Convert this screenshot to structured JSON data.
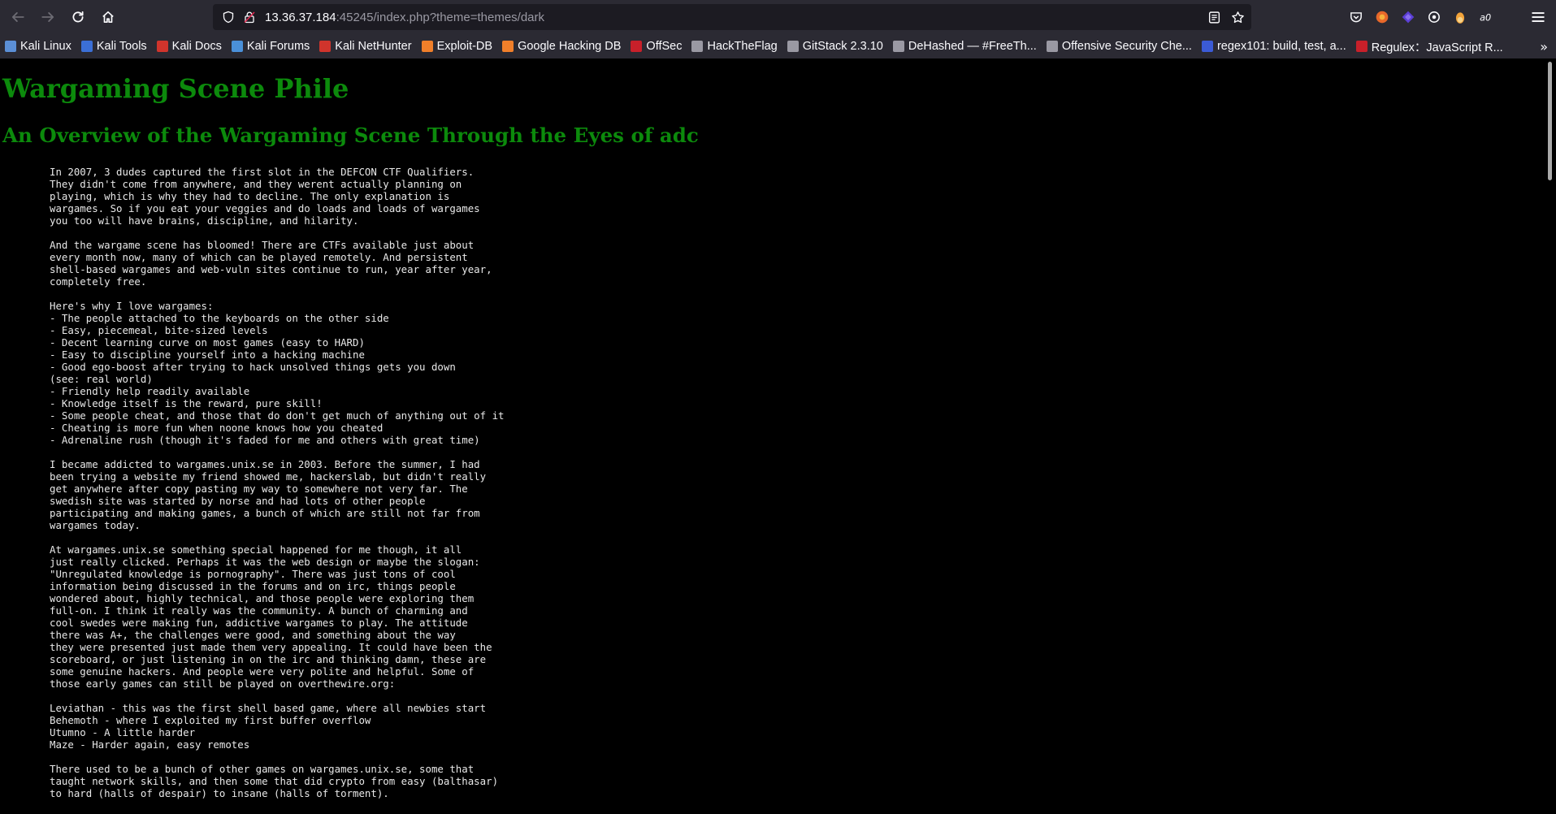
{
  "browser": {
    "url_host": "13.36.37.184",
    "url_rest": ":45245/index.php?theme=themes/dark"
  },
  "bookmarks": [
    {
      "label": "Kali Linux",
      "color": "#5b8fd6"
    },
    {
      "label": "Kali Tools",
      "color": "#3b6fd6"
    },
    {
      "label": "Kali Docs",
      "color": "#d0342c"
    },
    {
      "label": "Kali Forums",
      "color": "#4a90d9"
    },
    {
      "label": "Kali NetHunter",
      "color": "#d0342c"
    },
    {
      "label": "Exploit-DB",
      "color": "#f07f2a"
    },
    {
      "label": "Google Hacking DB",
      "color": "#f07f2a"
    },
    {
      "label": "OffSec",
      "color": "#c8202a"
    },
    {
      "label": "HackTheFlag",
      "color": "#9a99a3"
    },
    {
      "label": "GitStack 2.3.10",
      "color": "#9a99a3"
    },
    {
      "label": "DeHashed — #FreeTh...",
      "color": "#9a99a3"
    },
    {
      "label": "Offensive Security Che...",
      "color": "#9a99a3"
    },
    {
      "label": "regex101: build, test, a...",
      "color": "#3b5bd6"
    },
    {
      "label": "Regulex：JavaScript R...",
      "color": "#c8202a"
    }
  ],
  "page": {
    "title": "Wargaming Scene Phile",
    "subtitle": "An Overview of the Wargaming Scene Through the Eyes of adc",
    "article": "In 2007, 3 dudes captured the first slot in the DEFCON CTF Qualifiers.\nThey didn't come from anywhere, and they werent actually planning on\nplaying, which is why they had to decline. The only explanation is\nwargames. So if you eat your veggies and do loads and loads of wargames\nyou too will have brains, discipline, and hilarity.\n\nAnd the wargame scene has bloomed! There are CTFs available just about\nevery month now, many of which can be played remotely. And persistent\nshell-based wargames and web-vuln sites continue to run, year after year,\ncompletely free.\n\nHere's why I love wargames:\n- The people attached to the keyboards on the other side\n- Easy, piecemeal, bite-sized levels\n- Decent learning curve on most games (easy to HARD)\n- Easy to discipline yourself into a hacking machine\n- Good ego-boost after trying to hack unsolved things gets you down\n(see: real world)\n- Friendly help readily available\n- Knowledge itself is the reward, pure skill!\n- Some people cheat, and those that do don't get much of anything out of it\n- Cheating is more fun when noone knows how you cheated\n- Adrenaline rush (though it's faded for me and others with great time)\n\nI became addicted to wargames.unix.se in 2003. Before the summer, I had\nbeen trying a website my friend showed me, hackerslab, but didn't really\nget anywhere after copy pasting my way to somewhere not very far. The\nswedish site was started by norse and had lots of other people\nparticipating and making games, a bunch of which are still not far from\nwargames today.\n\nAt wargames.unix.se something special happened for me though, it all\njust really clicked. Perhaps it was the web design or maybe the slogan:\n\"Unregulated knowledge is pornography\". There was just tons of cool\ninformation being discussed in the forums and on irc, things people\nwondered about, highly technical, and those people were exploring them\nfull-on. I think it really was the community. A bunch of charming and\ncool swedes were making fun, addictive wargames to play. The attitude\nthere was A+, the challenges were good, and something about the way\nthey were presented just made them very appealing. It could have been the\nscoreboard, or just listening in on the irc and thinking damn, these are\nsome genuine hackers. And people were very polite and helpful. Some of\nthose early games can still be played on overthewire.org:\n\nLeviathan - this was the first shell based game, where all newbies start\nBehemoth - where I exploited my first buffer overflow\nUtumno - A little harder\nMaze - Harder again, easy remotes\n\nThere used to be a bunch of other games on wargames.unix.se, some that\ntaught network skills, and then some that did crypto from easy (balthasar)\nto hard (halls of despair) to insane (halls of torment)."
  }
}
